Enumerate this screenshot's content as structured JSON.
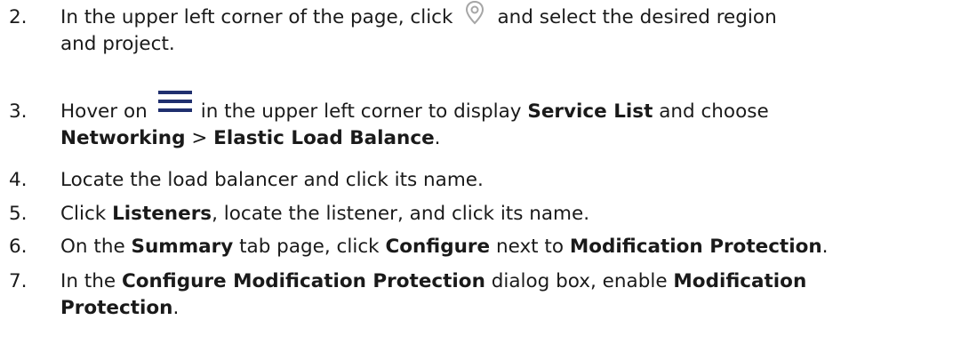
{
  "steps": [
    {
      "number": "2.",
      "line1_before_icon": "In the upper left corner of the page, click",
      "icon": "location-pin-icon",
      "line1_after_icon": "and select the desired region",
      "line2": "and project."
    },
    {
      "number": "3.",
      "line1_before_icon": "Hover on",
      "icon": "hamburger-menu-icon",
      "line1_after_icon_a": "in the upper left corner to display",
      "line1_bold_a": "Service List",
      "line1_after_icon_b": "and choose",
      "line2_bold_a": "Networking",
      "line2_sep": ">",
      "line2_bold_b": "Elastic Load Balance",
      "line2_end": "."
    },
    {
      "number": "4.",
      "text": "Locate the load balancer and click its name."
    },
    {
      "number": "5.",
      "text_a": "Click",
      "bold_a": "Listeners",
      "text_b": ", locate the listener, and click its name."
    },
    {
      "number": "6.",
      "text_a": "On the",
      "bold_a": "Summary",
      "text_b": "tab page, click",
      "bold_b": "Configure",
      "text_c": "next to",
      "bold_c": "Modification Protection",
      "text_d": "."
    },
    {
      "number": "7.",
      "text_a": "In the",
      "bold_a": "Configure Modification Protection",
      "text_b": "dialog box, enable",
      "bold_b": "Modification",
      "line2_bold": "Protection",
      "line2_end": "."
    }
  ],
  "colors": {
    "text": "#1a1a1a",
    "pin_icon": "#a6a6a6",
    "menu_icon": "#1f2f6e"
  }
}
